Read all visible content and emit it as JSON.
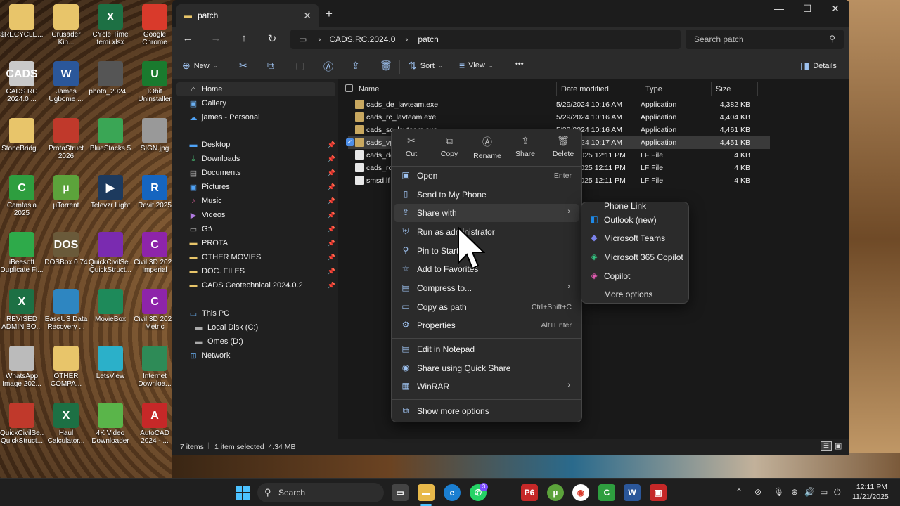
{
  "desktop": {
    "icons": [
      {
        "label": "$RECYCLE...",
        "glyph": "",
        "color": "#e8c56a"
      },
      {
        "label": "Crusader Kin...",
        "glyph": "",
        "color": "#e8c56a"
      },
      {
        "label": "CYcle Time temi.xlsx",
        "glyph": "X",
        "color": "#1d7044"
      },
      {
        "label": "Google Chrome",
        "glyph": "",
        "color": "#d93a2b"
      },
      {
        "label": "CADS RC 2024.0 ...",
        "glyph": "CADS",
        "color": "#c9c9c9"
      },
      {
        "label": "James Ugbome ...",
        "glyph": "W",
        "color": "#2b579a"
      },
      {
        "label": "photo_2024...",
        "glyph": "",
        "color": "#555"
      },
      {
        "label": "IObit Uninstaller",
        "glyph": "U",
        "color": "#1a7a2e"
      },
      {
        "label": "StoneBridg...",
        "glyph": "",
        "color": "#e8c56a"
      },
      {
        "label": "ProtaStruct 2026",
        "glyph": "",
        "color": "#c0392b"
      },
      {
        "label": "BlueStacks 5",
        "glyph": "",
        "color": "#3aa655"
      },
      {
        "label": "SIGN.jpg",
        "glyph": "",
        "color": "#999"
      },
      {
        "label": "Camtasia 2025",
        "glyph": "C",
        "color": "#2e9e3f"
      },
      {
        "label": "µTorrent",
        "glyph": "µ",
        "color": "#5ca33b"
      },
      {
        "label": "Televzr Light",
        "glyph": "▶",
        "color": "#1d3a5e"
      },
      {
        "label": "Revit 2025",
        "glyph": "R",
        "color": "#1565c0"
      },
      {
        "label": "iBeesoft Duplicate Fi...",
        "glyph": "",
        "color": "#2eaa4a"
      },
      {
        "label": "DOSBox 0.74",
        "glyph": "DOS",
        "color": "#6a5a3a"
      },
      {
        "label": "QuickCivilSe... QuickStruct...",
        "glyph": "",
        "color": "#7a2bb0"
      },
      {
        "label": "Civil 3D 2024 Imperial",
        "glyph": "C",
        "color": "#8e24aa"
      },
      {
        "label": "REVISED ADMIN BO...",
        "glyph": "X",
        "color": "#1d7044"
      },
      {
        "label": "EaseUS Data Recovery ...",
        "glyph": "",
        "color": "#2e86c1"
      },
      {
        "label": "MovieBox",
        "glyph": "",
        "color": "#1e8a5a"
      },
      {
        "label": "Civil 3D 2025 Metric",
        "glyph": "C",
        "color": "#8e24aa"
      },
      {
        "label": "WhatsApp Image 202...",
        "glyph": "",
        "color": "#bbb"
      },
      {
        "label": "OTHER COMPA...",
        "glyph": "",
        "color": "#e8c56a"
      },
      {
        "label": "LetsView",
        "glyph": "",
        "color": "#2bb0c9"
      },
      {
        "label": "Internet Downloa...",
        "glyph": "",
        "color": "#2e8b57"
      },
      {
        "label": "QuickCivilSe... QuickStruct...",
        "glyph": "",
        "color": "#c0392b"
      },
      {
        "label": "Haul Calculator...",
        "glyph": "X",
        "color": "#1d7044"
      },
      {
        "label": "4K Video Downloader",
        "glyph": "",
        "color": "#5ab54a"
      },
      {
        "label": "AutoCAD 2024 - ...",
        "glyph": "A",
        "color": "#c62828"
      }
    ]
  },
  "window": {
    "tab_title": "patch",
    "breadcrumb": [
      "CADS.RC.2024.0",
      "patch"
    ],
    "search_placeholder": "Search patch",
    "toolbar": {
      "new": "New",
      "sort": "Sort",
      "view": "View",
      "more": "•••",
      "details": "Details"
    },
    "nav": {
      "home": "Home",
      "gallery": "Gallery",
      "personal": "james - Personal",
      "quick": [
        "Desktop",
        "Downloads",
        "Documents",
        "Pictures",
        "Music",
        "Videos",
        "G:\\",
        "PROTA",
        "OTHER MOVIES",
        "DOC. FILES",
        "CADS Geotechnical 2024.0.2"
      ],
      "thispc": "This PC",
      "drives": [
        "Local Disk (C:)",
        "Omes (D:)"
      ],
      "network": "Network"
    },
    "columns": {
      "name": "Name",
      "date": "Date modified",
      "type": "Type",
      "size": "Size"
    },
    "files": [
      {
        "name": "cads_de_lavteam.exe",
        "date": "5/29/2024 10:16 AM",
        "type": "Application",
        "size": "4,382 KB"
      },
      {
        "name": "cads_rc_lavteam.exe",
        "date": "5/29/2024 10:16 AM",
        "type": "Application",
        "size": "4,404 KB"
      },
      {
        "name": "cads_sc_lavteam.exe",
        "date": "5/29/2024 10:16 AM",
        "type": "Application",
        "size": "4,461 KB"
      },
      {
        "name": "cads_vp_lavteam.exe",
        "date": "5/29/2024 10:17 AM",
        "type": "Application",
        "size": "4,451 KB"
      },
      {
        "name": "cads_de.lf",
        "date": "11/21/2025 12:11 PM",
        "type": "LF File",
        "size": "4 KB"
      },
      {
        "name": "cads_rc.lf",
        "date": "11/21/2025 12:11 PM",
        "type": "LF File",
        "size": "4 KB"
      },
      {
        "name": "smsd.lf",
        "date": "11/21/2025 12:11 PM",
        "type": "LF File",
        "size": "4 KB"
      }
    ],
    "status": {
      "count": "7 items",
      "selected": "1 item selected  4.34 MB"
    }
  },
  "context_menu": {
    "quick": [
      "Cut",
      "Copy",
      "Rename",
      "Share",
      "Delete"
    ],
    "items": [
      {
        "label": "Open",
        "key": "Enter",
        "icon": "▣"
      },
      {
        "label": "Send to My Phone",
        "key": "",
        "icon": "▯"
      },
      {
        "label": "Share with",
        "key": "",
        "icon": "⇪",
        "arrow": true
      },
      {
        "label": "Run as administrator",
        "key": "",
        "icon": "⛨"
      },
      {
        "label": "Pin to Start",
        "key": "",
        "icon": "⚲"
      },
      {
        "label": "Add to Favorites",
        "key": "",
        "icon": "☆"
      },
      {
        "label": "Compress to...",
        "key": "",
        "icon": "▤",
        "arrow": true
      },
      {
        "label": "Copy as path",
        "key": "Ctrl+Shift+C",
        "icon": "▭"
      },
      {
        "label": "Properties",
        "key": "Alt+Enter",
        "icon": "⚙"
      },
      {
        "label": "Edit in Notepad",
        "key": "",
        "icon": "▤"
      },
      {
        "label": "Share using Quick Share",
        "key": "",
        "icon": "◉"
      },
      {
        "label": "WinRAR",
        "key": "",
        "icon": "▦",
        "arrow": true
      },
      {
        "label": "Show more options",
        "key": "",
        "icon": "⧉"
      }
    ]
  },
  "submenu": {
    "items": [
      "Phone Link",
      "Outlook (new)",
      "Microsoft Teams",
      "Microsoft 365 Copilot",
      "Copilot",
      "More options"
    ]
  },
  "taskbar": {
    "search": "Search",
    "time": "12:11 PM",
    "date": "11/21/2025",
    "whatsapp_badge": "3"
  }
}
